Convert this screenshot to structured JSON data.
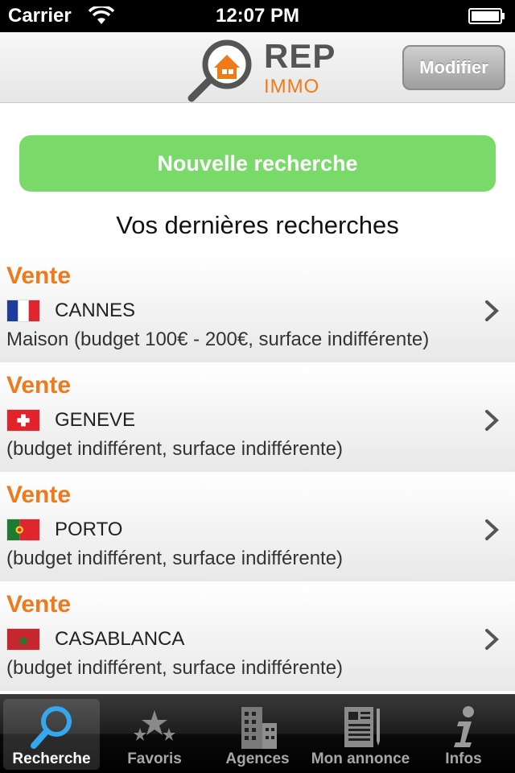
{
  "status_bar": {
    "carrier": "Carrier",
    "time": "12:07 PM"
  },
  "header": {
    "logo_top": "REP",
    "logo_bottom": "IMMO",
    "modify_label": "Modifier"
  },
  "main": {
    "new_search_label": "Nouvelle recherche",
    "section_title": "Vos dernières recherches",
    "searches": [
      {
        "type": "Vente",
        "flag": "france-flag",
        "city": "CANNES",
        "description": "Maison (budget 100€ - 200€, surface indifférente)"
      },
      {
        "type": "Vente",
        "flag": "switzerland-flag",
        "city": "GENEVE",
        "description": " (budget indifférent, surface indifférente)"
      },
      {
        "type": "Vente",
        "flag": "portugal-flag",
        "city": "PORTO",
        "description": " (budget indifférent, surface indifférente)"
      },
      {
        "type": "Vente",
        "flag": "morocco-flag",
        "city": "CASABLANCA",
        "description": " (budget indifférent, surface indifférente)"
      }
    ]
  },
  "tab_bar": {
    "tabs": [
      {
        "label": "Recherche",
        "icon": "magnifier-icon",
        "active": true
      },
      {
        "label": "Favoris",
        "icon": "stars-icon",
        "active": false
      },
      {
        "label": "Agences",
        "icon": "buildings-icon",
        "active": false
      },
      {
        "label": "Mon annonce",
        "icon": "newspaper-icon",
        "active": false
      },
      {
        "label": "Infos",
        "icon": "info-icon",
        "active": false
      }
    ]
  },
  "colors": {
    "accent": "#f07a1a",
    "new_search": "#79d969",
    "tab_active": "#1a8fe0"
  }
}
